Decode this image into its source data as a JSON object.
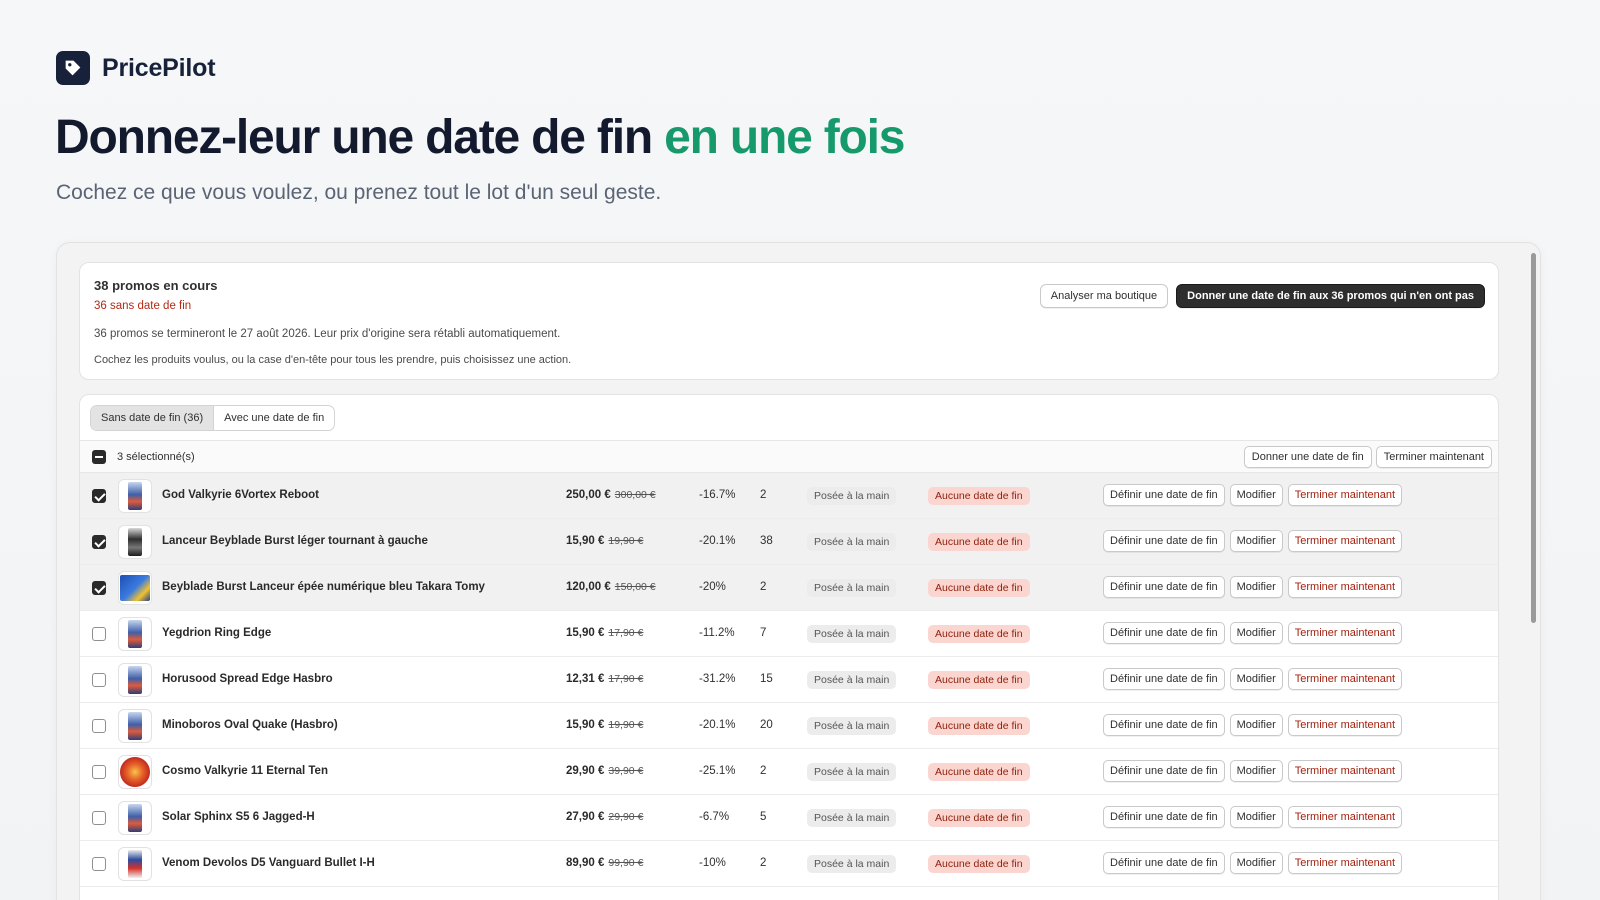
{
  "brand": {
    "name": "PricePilot",
    "icon": "tag-icon"
  },
  "hero": {
    "title_main": "Donnez-leur une date de fin ",
    "title_accent": "en une fois",
    "subtitle": "Cochez ce que vous voulez, ou prenez tout le lot d'un seul geste."
  },
  "colors": {
    "accent": "#169a6c",
    "brand_dark": "#17213a",
    "danger": "#b32a16",
    "danger_bg": "#fbd6d0"
  },
  "summary": {
    "count": "38 promos en cours",
    "missing": "36 sans date de fin",
    "end_note": "36 promos se termineront le 27 août 2026. Leur prix d'origine sera rétabli automatiquement.",
    "help": "Cochez les produits voulus, ou la case d'en-tête pour tous les prendre, puis choisissez une action.",
    "analyze_label": "Analyser ma boutique",
    "bulk_primary_label": "Donner une date de fin aux 36 promos qui n'en ont pas"
  },
  "tabs": [
    {
      "label": "Sans date de fin (36)",
      "active": true
    },
    {
      "label": "Avec une date de fin",
      "active": false
    }
  ],
  "bulk": {
    "selected_label": "3 sélectionné(s)",
    "set_end_label": "Donner une date de fin",
    "end_now_label": "Terminer maintenant"
  },
  "row_actions": {
    "set_end": "Définir une date de fin",
    "edit": "Modifier",
    "end_now": "Terminer maintenant"
  },
  "rows": [
    {
      "name": "God Valkyrie 6Vortex Reboot",
      "price": "250,00 €",
      "old_price": "300,00 €",
      "discount": "-16.7%",
      "qty": "2",
      "source": "Posée à la main",
      "status": "Aucune date de fin",
      "checked": true,
      "thumb": "pkg"
    },
    {
      "name": "Lanceur Beyblade Burst léger tournant à gauche",
      "price": "15,90 €",
      "old_price": "19,90 €",
      "discount": "-20.1%",
      "qty": "38",
      "source": "Posée à la main",
      "status": "Aucune date de fin",
      "checked": true,
      "thumb": "dark"
    },
    {
      "name": "Beyblade Burst Lanceur épée numérique bleu Takara Tomy",
      "price": "120,00 €",
      "old_price": "150,00 €",
      "discount": "-20%",
      "qty": "2",
      "source": "Posée à la main",
      "status": "Aucune date de fin",
      "checked": true,
      "thumb": "box"
    },
    {
      "name": "Yegdrion Ring Edge",
      "price": "15,90 €",
      "old_price": "17,90 €",
      "discount": "-11.2%",
      "qty": "7",
      "source": "Posée à la main",
      "status": "Aucune date de fin",
      "checked": false,
      "thumb": "pkg"
    },
    {
      "name": "Horusood Spread Edge Hasbro",
      "price": "12,31 €",
      "old_price": "17,90 €",
      "discount": "-31.2%",
      "qty": "15",
      "source": "Posée à la main",
      "status": "Aucune date de fin",
      "checked": false,
      "thumb": "pkg"
    },
    {
      "name": "Minoboros Oval Quake (Hasbro)",
      "price": "15,90 €",
      "old_price": "19,90 €",
      "discount": "-20.1%",
      "qty": "20",
      "source": "Posée à la main",
      "status": "Aucune date de fin",
      "checked": false,
      "thumb": "pkg"
    },
    {
      "name": "Cosmo Valkyrie 11 Eternal Ten",
      "price": "29,90 €",
      "old_price": "39,90 €",
      "discount": "-25.1%",
      "qty": "2",
      "source": "Posée à la main",
      "status": "Aucune date de fin",
      "checked": false,
      "thumb": "top"
    },
    {
      "name": "Solar Sphinx S5 6 Jagged-H",
      "price": "27,90 €",
      "old_price": "29,90 €",
      "discount": "-6.7%",
      "qty": "5",
      "source": "Posée à la main",
      "status": "Aucune date de fin",
      "checked": false,
      "thumb": "pkg"
    },
    {
      "name": "Venom Devolos D5 Vanguard Bullet I-H",
      "price": "89,90 €",
      "old_price": "99,90 €",
      "discount": "-10%",
      "qty": "2",
      "source": "Posée à la main",
      "status": "Aucune date de fin",
      "checked": false,
      "thumb": "red"
    }
  ]
}
